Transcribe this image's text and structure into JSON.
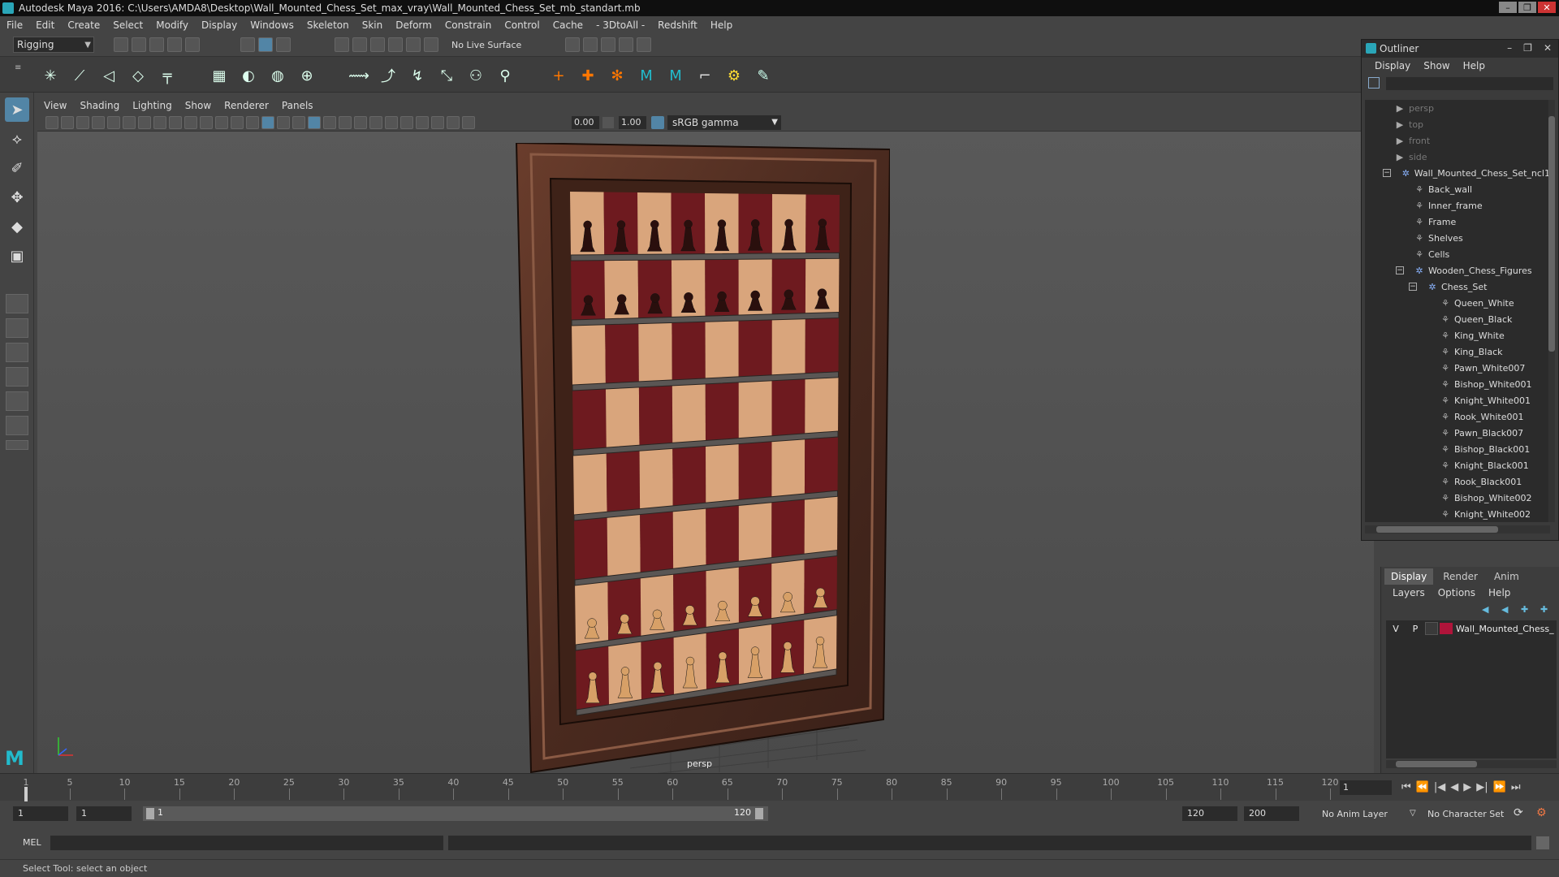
{
  "window": {
    "title": "Autodesk Maya 2016: C:\\Users\\AMDA8\\Desktop\\Wall_Mounted_Chess_Set_max_vray\\Wall_Mounted_Chess_Set_mb_standart.mb",
    "controls": [
      "–",
      "❐",
      "✕"
    ]
  },
  "menubar": [
    "File",
    "Edit",
    "Create",
    "Select",
    "Modify",
    "Display",
    "Windows",
    "Skeleton",
    "Skin",
    "Deform",
    "Constrain",
    "Control",
    "Cache",
    "- 3DtoAll -",
    "Redshift",
    "Help"
  ],
  "toolbar": {
    "mode": "Rigging",
    "live_surface": "No Live Surface"
  },
  "viewport": {
    "menu": [
      "View",
      "Shading",
      "Lighting",
      "Show",
      "Renderer",
      "Panels"
    ],
    "exposure": "0.00",
    "gamma": "1.00",
    "color_space": "sRGB gamma",
    "camera": "persp"
  },
  "outliner": {
    "title": "Outliner",
    "menu": [
      "Display",
      "Show",
      "Help"
    ],
    "items": [
      {
        "label": "persp",
        "level": 0,
        "kind": "camera"
      },
      {
        "label": "top",
        "level": 0,
        "kind": "camera"
      },
      {
        "label": "front",
        "level": 0,
        "kind": "camera"
      },
      {
        "label": "side",
        "level": 0,
        "kind": "camera"
      },
      {
        "label": "Wall_Mounted_Chess_Set_ncl1",
        "level": 0,
        "kind": "group",
        "toggle": "−"
      },
      {
        "label": "Back_wall",
        "level": 1,
        "kind": "mesh"
      },
      {
        "label": "Inner_frame",
        "level": 1,
        "kind": "mesh"
      },
      {
        "label": "Frame",
        "level": 1,
        "kind": "mesh"
      },
      {
        "label": "Shelves",
        "level": 1,
        "kind": "mesh"
      },
      {
        "label": "Cells",
        "level": 1,
        "kind": "mesh"
      },
      {
        "label": "Wooden_Chess_Figures",
        "level": 1,
        "kind": "group",
        "toggle": "−"
      },
      {
        "label": "Chess_Set",
        "level": 2,
        "kind": "group",
        "toggle": "−"
      },
      {
        "label": "Queen_White",
        "level": 3,
        "kind": "mesh"
      },
      {
        "label": "Queen_Black",
        "level": 3,
        "kind": "mesh"
      },
      {
        "label": "King_White",
        "level": 3,
        "kind": "mesh"
      },
      {
        "label": "King_Black",
        "level": 3,
        "kind": "mesh"
      },
      {
        "label": "Pawn_White007",
        "level": 3,
        "kind": "mesh"
      },
      {
        "label": "Bishop_White001",
        "level": 3,
        "kind": "mesh"
      },
      {
        "label": "Knight_White001",
        "level": 3,
        "kind": "mesh"
      },
      {
        "label": "Rook_White001",
        "level": 3,
        "kind": "mesh"
      },
      {
        "label": "Pawn_Black007",
        "level": 3,
        "kind": "mesh"
      },
      {
        "label": "Bishop_Black001",
        "level": 3,
        "kind": "mesh"
      },
      {
        "label": "Knight_Black001",
        "level": 3,
        "kind": "mesh"
      },
      {
        "label": "Rook_Black001",
        "level": 3,
        "kind": "mesh"
      },
      {
        "label": "Bishop_White002",
        "level": 3,
        "kind": "mesh"
      },
      {
        "label": "Knight_White002",
        "level": 3,
        "kind": "mesh"
      }
    ]
  },
  "layer_editor": {
    "tabs": [
      "Display",
      "Render",
      "Anim"
    ],
    "active_tab": "Display",
    "menu": [
      "Layers",
      "Options",
      "Help"
    ],
    "layers": [
      {
        "v": "V",
        "p": "P",
        "color": "#b0143a",
        "name": "Wall_Mounted_Chess_"
      }
    ]
  },
  "timeline": {
    "ticks": [
      1,
      5,
      10,
      15,
      20,
      25,
      30,
      35,
      40,
      45,
      50,
      55,
      60,
      65,
      70,
      75,
      80,
      85,
      90,
      95,
      100,
      105,
      110,
      115,
      120
    ],
    "current_frame": "1",
    "transport": [
      "⏮",
      "⏪",
      "|◀",
      "◀",
      "▶",
      "▶|",
      "⏩",
      "⏭"
    ]
  },
  "range": {
    "start": "1",
    "playback_start": "1",
    "slider_start": "1",
    "slider_end": "120",
    "playback_end": "120",
    "end": "200",
    "anim_layer": "No Anim Layer",
    "character_set": "No Character Set"
  },
  "command_line": {
    "label": "MEL"
  },
  "help_line": "Select Tool: select an object",
  "colors": {
    "accent": "#5285a6",
    "frame_wood": "#4a2a1f",
    "dark_square": "#6e1a1f",
    "light_square": "#d9a57c",
    "black_piece": "#2a0f0d",
    "white_piece": "#d7a067"
  }
}
